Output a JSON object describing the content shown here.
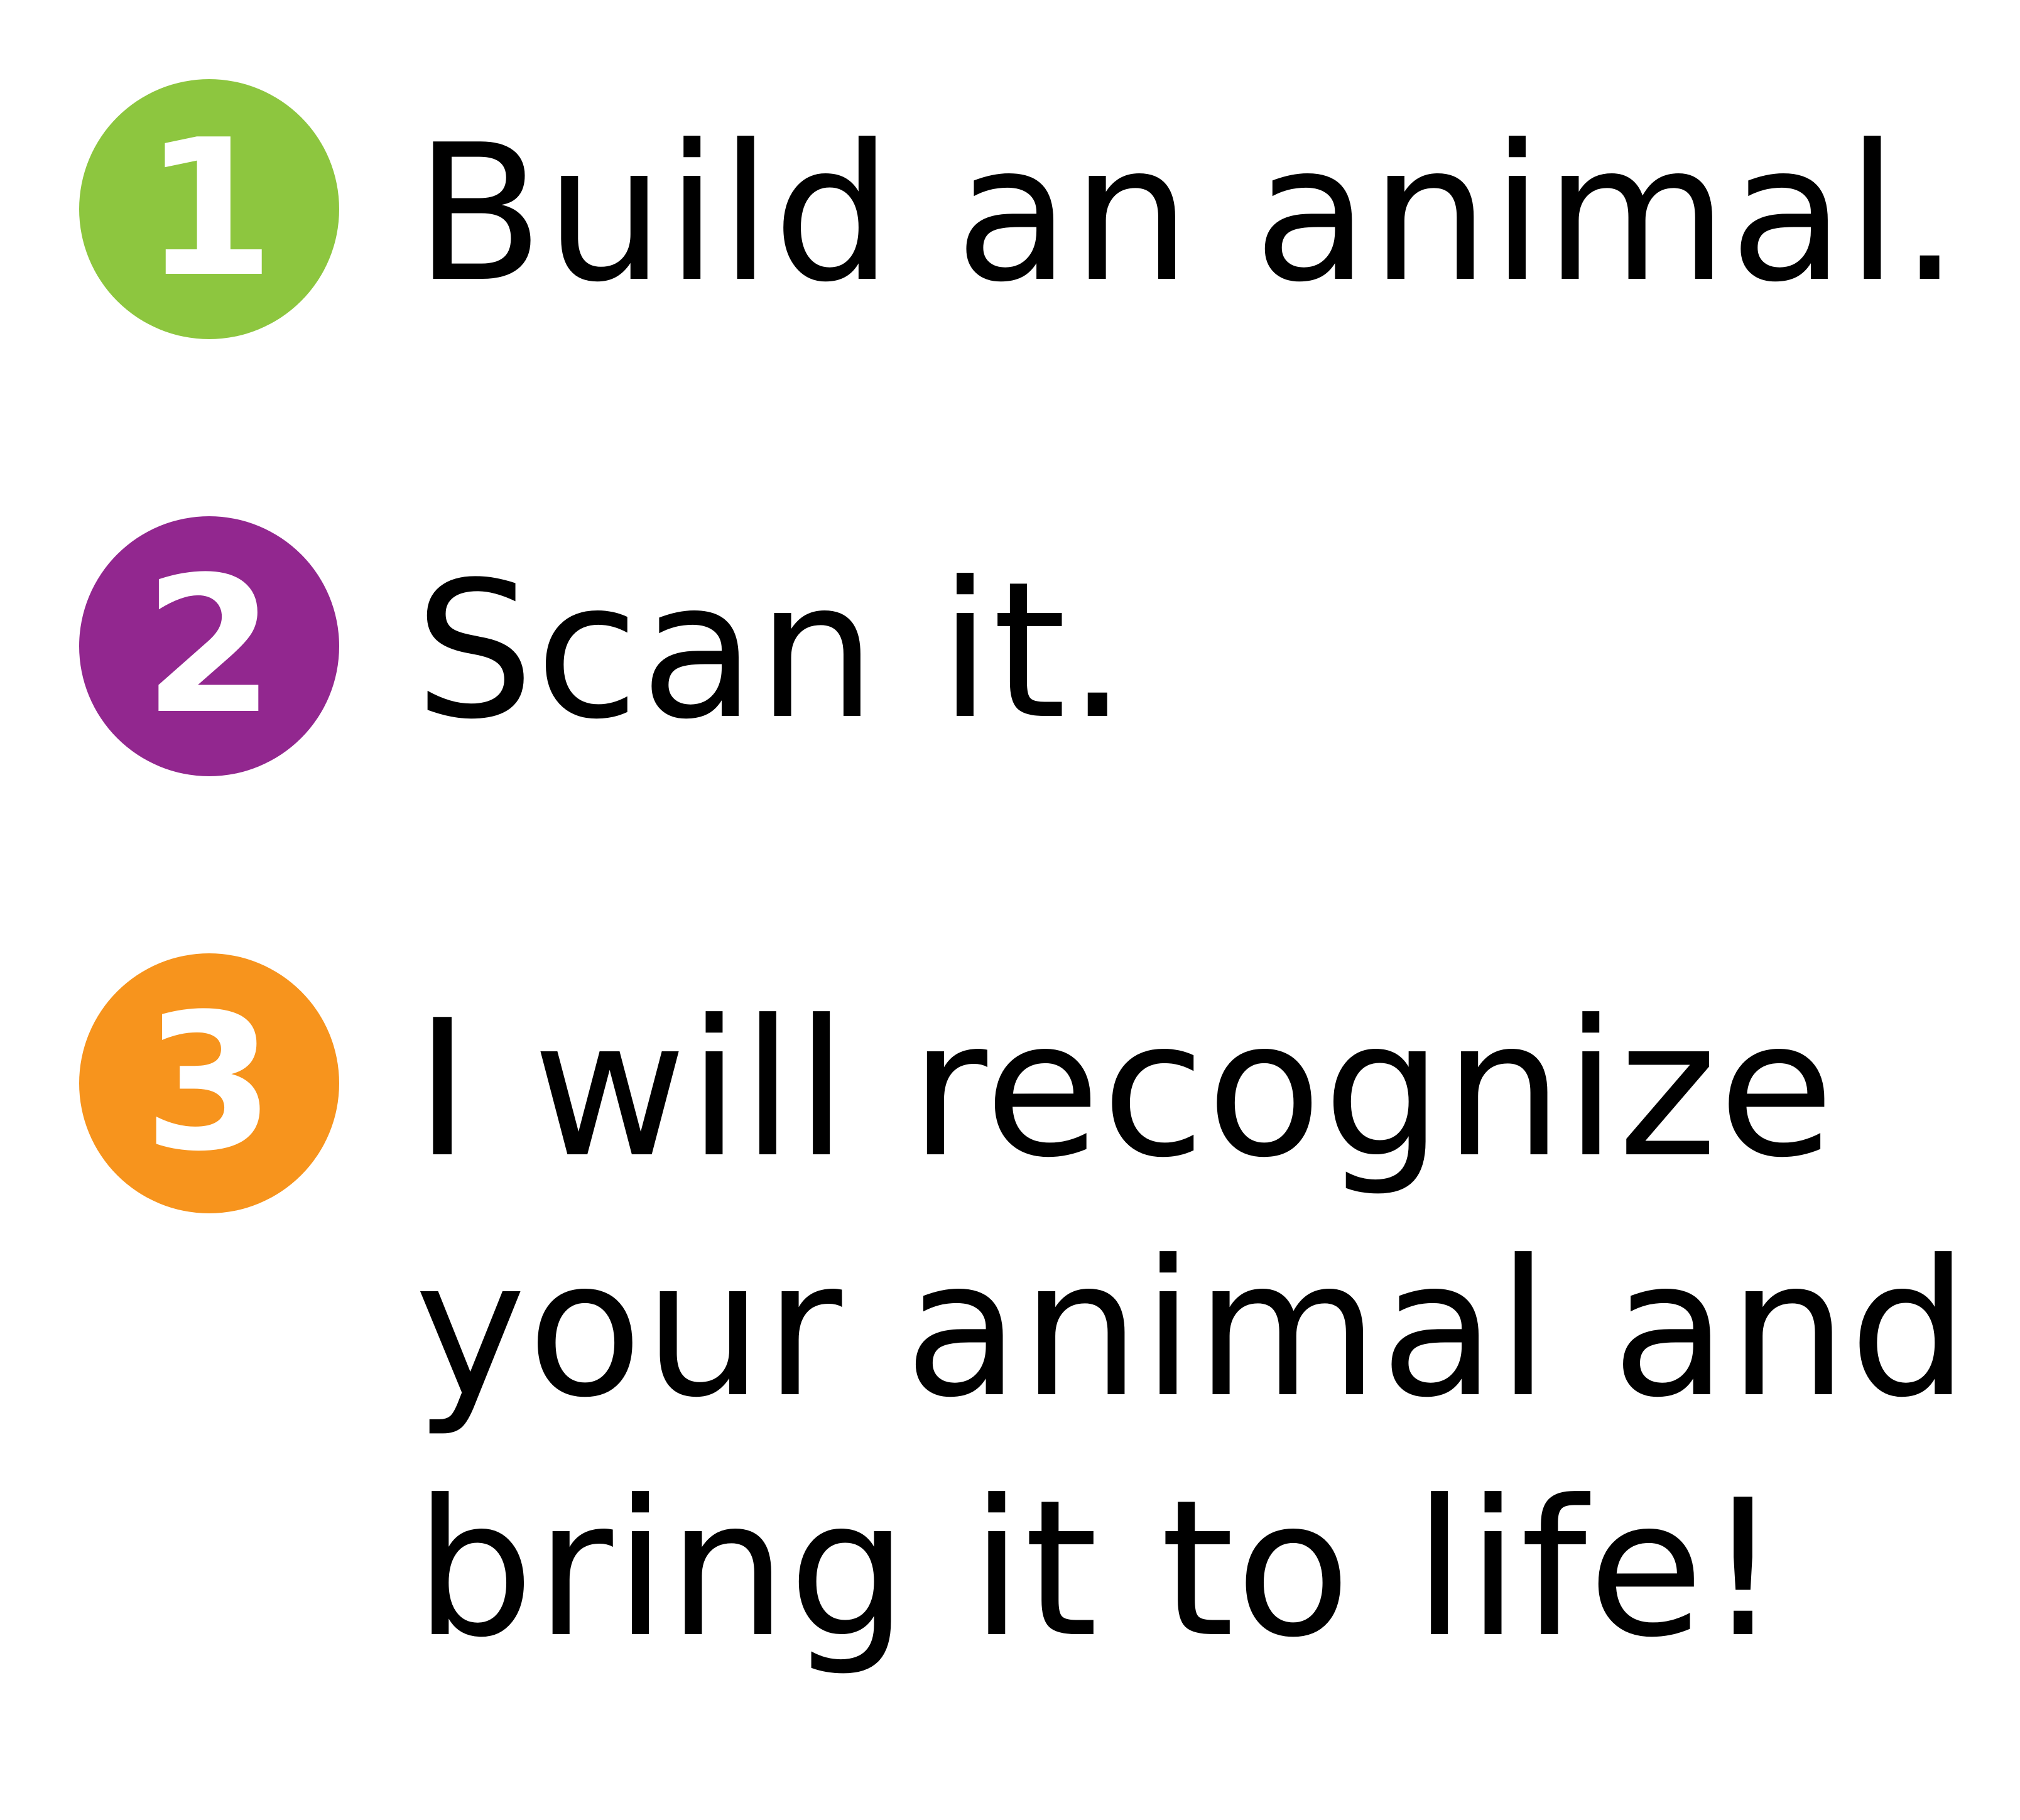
{
  "steps": [
    {
      "number": "1",
      "color": "#8dc63f",
      "lines": [
        "Build an animal."
      ]
    },
    {
      "number": "2",
      "color": "#92278f",
      "lines": [
        "Scan it."
      ]
    },
    {
      "number": "3",
      "color": "#f7941d",
      "lines": [
        "I will recognize",
        "your animal and",
        "bring it to life!"
      ]
    }
  ]
}
